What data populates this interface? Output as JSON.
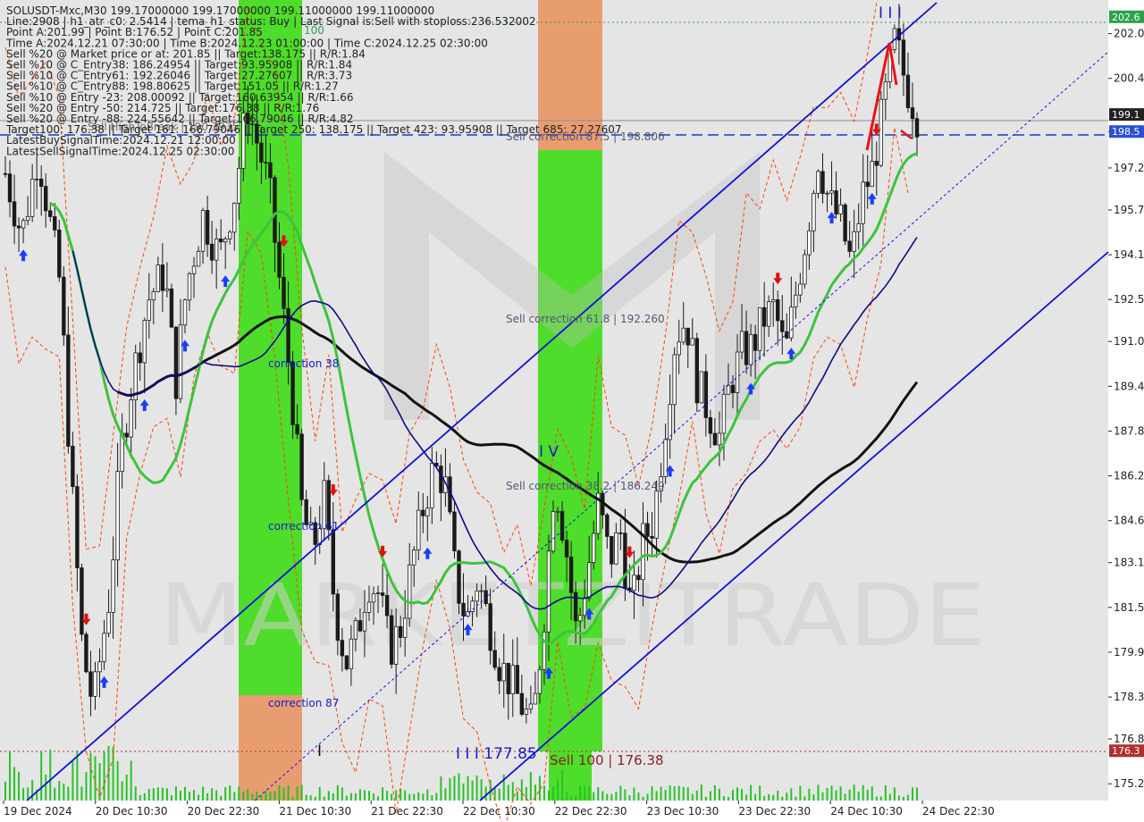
{
  "colors": {
    "bg_panel": "#e5e5e5",
    "axis_bg": "#ffffff",
    "candle": "#1a1a1a",
    "channel": "#1010dd",
    "ma_green": "#3cc43c",
    "ma_black": "#111111",
    "ma_navy": "#0b0b8a",
    "envelope": "#ff4400",
    "buy_arrow": "#1a3cff",
    "sell_arrow": "#e01010",
    "green_zone": "#3ddc15",
    "orange_zone": "#e8844a",
    "green_tag": "#2aa24a",
    "blue_tag": "#2c4fd6",
    "red_tag": "#b03030",
    "dark_tag": "#222222"
  },
  "info_lines": [
    "SOLUSDT-Mxc,M30  199.17000000 199.17000000 199.11000000 199.11000000",
    "Line:2908 | h1_atr_c0: 2.5414 | tema_h1_status: Buy | Last Signal is:Sell with stoploss:236.532002",
    "Point A:201.99 | Point B:176.52 | Point C:201.85",
    "Time A:2024.12.21 07:30:00 | Time B:2024.12.23 01:00:00 | Time C:2024.12.25 02:30:00",
    "Sell %20 @ Market price or at: 201.85 || Target:138.175 || R/R:1.84",
    "Sell %10 @ C_Entry38: 186.24954 || Target:93.95908 || R/R:1.84",
    "Sell %10 @ C_Entry61: 192.26046 || Target:27.27607 || R/R:3.73",
    "Sell %10 @ C_Entry88: 198.80625 || Target:151.05 || R/R:1.27",
    "Sell %10 @ Entry -23: 208.00092 || Target:160.63954 || R/R:1.66",
    "Sell %20 @ Entry -50: 214.725 || Target:176.38 || R/R:1.76",
    "Sell %20 @ Entry -88: 224.55642 || Target:166.79046 || R/R:4.82",
    "Target100: 176.38 || Target 161: 166.79046 || Target 250: 138.175 || Target 423: 93.95908 || Target 685: 27.27607",
    "LatestBuySignalTime:2024.12.21 12:00:00",
    "LatestSellSignalTime:2024.12.25 02:30:00"
  ],
  "overlay_small": "Sell HighToBreak | 190.3935",
  "price_ticks": [
    "202.0",
    "200.4",
    "198.5",
    "197.2",
    "195.7",
    "194.1",
    "192.5",
    "191.0",
    "189.4",
    "187.8",
    "186.2",
    "184.6",
    "183.1",
    "181.5",
    "179.9",
    "178.3",
    "176.8",
    "175.2"
  ],
  "time_ticks": [
    "19 Dec 2024",
    "20 Dec 10:30",
    "20 Dec 22:30",
    "21 Dec 10:30",
    "21 Dec 22:30",
    "22 Dec 10:30",
    "22 Dec 22:30",
    "23 Dec 10:30",
    "23 Dec 22:30",
    "24 Dec 10:30",
    "24 Dec 22:30"
  ],
  "price_tags": [
    {
      "value": 202.6,
      "text": "202.6",
      "kind": "green"
    },
    {
      "value": 199.11,
      "text": "199.1",
      "kind": "dark"
    },
    {
      "value": 198.5,
      "text": "198.5",
      "kind": "blue"
    },
    {
      "value": 176.38,
      "text": "176.3",
      "kind": "red"
    }
  ],
  "annotations": {
    "corr38": "correction 38",
    "corr61": "correction 61",
    "corr87": "correction 87",
    "sell_corr_875": "Sell correction 87.5 | 198.806",
    "sell_corr_618": "Sell correction 61.8 | 192.260",
    "sell_corr_382": "Sell correction 38.2 | 186.249",
    "wave_iii_top": "I I I",
    "wave_iv": "I V",
    "wave_iii_bottom": "I I I 177.85",
    "wave_i": "I",
    "sell_100": "Sell 100 | 176.38",
    "label_100": "100"
  },
  "watermark": "MARKETZITRADE",
  "chart_data": {
    "type": "candlestick",
    "symbol": "SOLUSDT-Mxc",
    "timeframe": "M30",
    "ylim": [
      174.6,
      203.2
    ],
    "x_start": "19 Dec 2024",
    "x_end": "24 Dec 22:30",
    "levels": {
      "sell_100": 176.38,
      "target_tp": 202.6,
      "bid": 199.11,
      "sell_corr_875": 198.806
    },
    "close_path": [
      {
        "t": 0,
        "v": 197.0
      },
      {
        "t": 3,
        "v": 194.8
      },
      {
        "t": 6,
        "v": 197.8
      },
      {
        "t": 10,
        "v": 193.0
      },
      {
        "t": 12,
        "v": 186.0
      },
      {
        "t": 14,
        "v": 180.0
      },
      {
        "t": 16,
        "v": 178.0
      },
      {
        "t": 19,
        "v": 182.0
      },
      {
        "t": 21,
        "v": 187.0
      },
      {
        "t": 23,
        "v": 189.5
      },
      {
        "t": 26,
        "v": 192.5
      },
      {
        "t": 29,
        "v": 193.5
      },
      {
        "t": 31,
        "v": 189.5
      },
      {
        "t": 33,
        "v": 193.0
      },
      {
        "t": 36,
        "v": 195.5
      },
      {
        "t": 39,
        "v": 194.0
      },
      {
        "t": 42,
        "v": 196.5
      },
      {
        "t": 44,
        "v": 199.5
      },
      {
        "t": 46,
        "v": 198.0
      },
      {
        "t": 48,
        "v": 196.5
      },
      {
        "t": 50,
        "v": 193.0
      },
      {
        "t": 52,
        "v": 189.5
      },
      {
        "t": 54,
        "v": 185.0
      },
      {
        "t": 56,
        "v": 183.5
      },
      {
        "t": 58,
        "v": 185.5
      },
      {
        "t": 60,
        "v": 181.5
      },
      {
        "t": 62,
        "v": 179.5
      },
      {
        "t": 64,
        "v": 180.5
      },
      {
        "t": 66,
        "v": 182.5
      },
      {
        "t": 68,
        "v": 182.0
      },
      {
        "t": 70,
        "v": 180.0
      },
      {
        "t": 72,
        "v": 180.8
      },
      {
        "t": 74,
        "v": 183.0
      },
      {
        "t": 76,
        "v": 185.0
      },
      {
        "t": 78,
        "v": 186.5
      },
      {
        "t": 80,
        "v": 186.0
      },
      {
        "t": 82,
        "v": 182.5
      },
      {
        "t": 84,
        "v": 181.0
      },
      {
        "t": 86,
        "v": 182.5
      },
      {
        "t": 88,
        "v": 181.0
      },
      {
        "t": 90,
        "v": 179.5
      },
      {
        "t": 92,
        "v": 178.8
      },
      {
        "t": 94,
        "v": 178.0
      },
      {
        "t": 96,
        "v": 177.2
      },
      {
        "t": 98,
        "v": 181.0
      },
      {
        "t": 100,
        "v": 186.2
      },
      {
        "t": 102,
        "v": 183.8
      },
      {
        "t": 104,
        "v": 180.5
      },
      {
        "t": 106,
        "v": 182.8
      },
      {
        "t": 108,
        "v": 185.2
      },
      {
        "t": 110,
        "v": 183.2
      },
      {
        "t": 112,
        "v": 184.2
      },
      {
        "t": 114,
        "v": 181.3
      },
      {
        "t": 116,
        "v": 183.8
      },
      {
        "t": 118,
        "v": 184.6
      },
      {
        "t": 120,
        "v": 187.8
      },
      {
        "t": 122,
        "v": 191.2
      },
      {
        "t": 124,
        "v": 191.8
      },
      {
        "t": 126,
        "v": 189.5
      },
      {
        "t": 128,
        "v": 188.5
      },
      {
        "t": 130,
        "v": 187.6
      },
      {
        "t": 132,
        "v": 189.5
      },
      {
        "t": 134,
        "v": 190.6
      },
      {
        "t": 136,
        "v": 190.8
      },
      {
        "t": 138,
        "v": 191.8
      },
      {
        "t": 140,
        "v": 192.2
      },
      {
        "t": 142,
        "v": 190.5
      },
      {
        "t": 144,
        "v": 192.8
      },
      {
        "t": 146,
        "v": 195.0
      },
      {
        "t": 148,
        "v": 197.6
      },
      {
        "t": 150,
        "v": 196.0
      },
      {
        "t": 152,
        "v": 195.3
      },
      {
        "t": 154,
        "v": 193.8
      },
      {
        "t": 156,
        "v": 196.2
      },
      {
        "t": 158,
        "v": 197.2
      },
      {
        "t": 160,
        "v": 199.5
      },
      {
        "t": 162,
        "v": 201.8
      },
      {
        "t": 164,
        "v": 200.2
      },
      {
        "t": 166,
        "v": 199.1
      }
    ],
    "series": [
      {
        "name": "",
        "kind": "ma_black"
      },
      {
        "name": "",
        "kind": "ma_green"
      },
      {
        "name": "",
        "kind": "ma_navy"
      }
    ]
  }
}
